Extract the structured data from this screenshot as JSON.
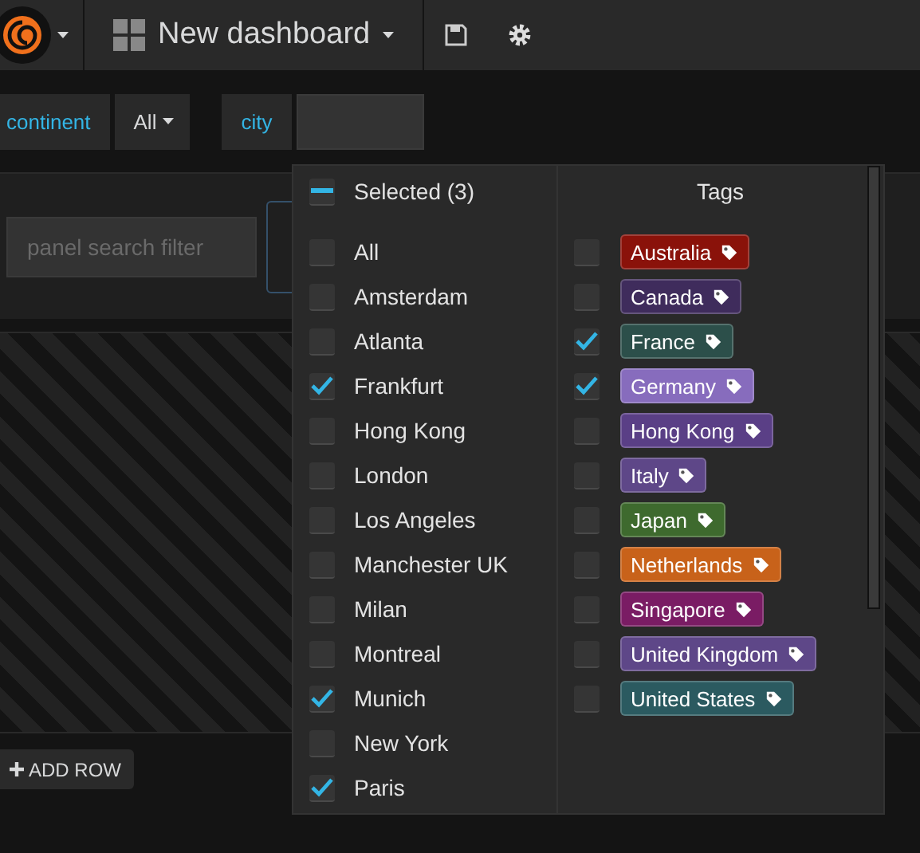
{
  "navbar": {
    "title": "New dashboard"
  },
  "variables": [
    {
      "label": "continent",
      "value": "All"
    },
    {
      "label": "city"
    }
  ],
  "panel_search": {
    "placeholder": "panel search filter"
  },
  "dropdown": {
    "header": "Selected (3)",
    "indeterminate": true,
    "tags_title": "Tags",
    "options": [
      {
        "label": "All",
        "checked": false
      },
      {
        "label": "Amsterdam",
        "checked": false
      },
      {
        "label": "Atlanta",
        "checked": false
      },
      {
        "label": "Frankfurt",
        "checked": true
      },
      {
        "label": "Hong Kong",
        "checked": false
      },
      {
        "label": "London",
        "checked": false
      },
      {
        "label": "Los Angeles",
        "checked": false
      },
      {
        "label": "Manchester UK",
        "checked": false
      },
      {
        "label": "Milan",
        "checked": false
      },
      {
        "label": "Montreal",
        "checked": false
      },
      {
        "label": "Munich",
        "checked": true
      },
      {
        "label": "New York",
        "checked": false
      },
      {
        "label": "Paris",
        "checked": true
      }
    ],
    "tags": [
      {
        "label": "Australia",
        "color": "#8a120a",
        "checked": false
      },
      {
        "label": "Canada",
        "color": "#3f2c5c",
        "checked": false
      },
      {
        "label": "France",
        "color": "#2c4f4a",
        "checked": true
      },
      {
        "label": "Germany",
        "color": "#876cbd",
        "checked": true
      },
      {
        "label": "Hong Kong",
        "color": "#5a3f86",
        "checked": false
      },
      {
        "label": "Italy",
        "color": "#5e4788",
        "checked": false
      },
      {
        "label": "Japan",
        "color": "#3e6a2e",
        "checked": false
      },
      {
        "label": "Netherlands",
        "color": "#c8621a",
        "checked": false
      },
      {
        "label": "Singapore",
        "color": "#7a1c64",
        "checked": false
      },
      {
        "label": "United Kingdom",
        "color": "#5e4788",
        "checked": false
      },
      {
        "label": "United States",
        "color": "#2b5a60",
        "checked": false
      }
    ]
  },
  "add_row": {
    "label": "ADD ROW"
  }
}
